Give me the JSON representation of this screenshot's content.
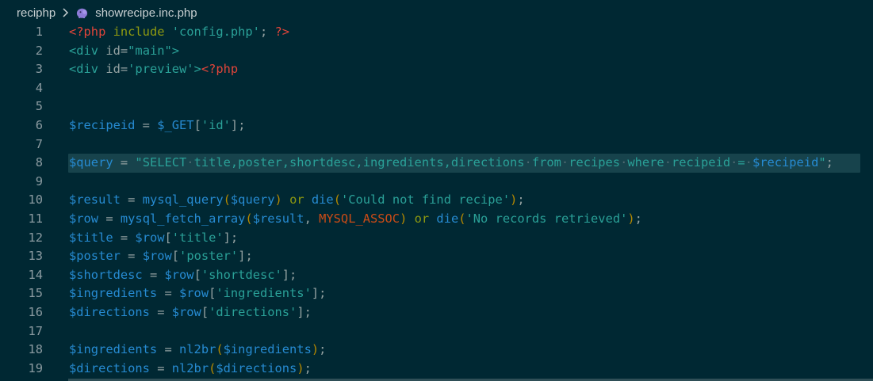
{
  "breadcrumb": {
    "folder": "reciphp",
    "file": "showrecipe.inc.php",
    "file_icon": "php-elephant-icon",
    "separator_icon": "chevron-right-icon"
  },
  "colors": {
    "background": "#002833",
    "line_numbers": "#8a9aa0",
    "highlight": "#17434c",
    "string": "#2aa198",
    "variable": "#268bd2",
    "keyword": "#8f9a10",
    "php_tag": "#e0453a",
    "bracket": "#b58900",
    "constant": "#cb4b16"
  },
  "editor": {
    "highlighted_line": 8,
    "lines": [
      {
        "n": "1",
        "tokens": [
          [
            "tag",
            "<?php"
          ],
          [
            "kw",
            " include "
          ],
          [
            "str",
            "'config.php'"
          ],
          [
            "pun",
            "; "
          ],
          [
            "tag",
            "?>"
          ]
        ]
      },
      {
        "n": "2",
        "tokens": [
          [
            "str",
            "<div "
          ],
          [
            "pun",
            "id="
          ],
          [
            "str",
            "\"main\""
          ],
          [
            "str",
            ">"
          ]
        ]
      },
      {
        "n": "3",
        "tokens": [
          [
            "str",
            "<div "
          ],
          [
            "pun",
            "id="
          ],
          [
            "str",
            "'preview'"
          ],
          [
            "str",
            ">"
          ],
          [
            "tag",
            "<?php"
          ]
        ]
      },
      {
        "n": "4",
        "tokens": []
      },
      {
        "n": "5",
        "tokens": []
      },
      {
        "n": "6",
        "tokens": [
          [
            "var",
            "$recipeid"
          ],
          [
            "pun",
            " = "
          ],
          [
            "var",
            "$_GET"
          ],
          [
            "pun",
            "["
          ],
          [
            "str",
            "'id'"
          ],
          [
            "pun",
            "];"
          ]
        ]
      },
      {
        "n": "7",
        "tokens": []
      },
      {
        "n": "8",
        "tokens": [
          [
            "var",
            "$query"
          ],
          [
            "pun",
            " = "
          ],
          [
            "str",
            "\"SELECT"
          ],
          [
            "dot",
            "·"
          ],
          [
            "str",
            "title,poster,shortdesc,ingredients,directions"
          ],
          [
            "dot",
            "·"
          ],
          [
            "str",
            "from"
          ],
          [
            "dot",
            "·"
          ],
          [
            "str",
            "recipes"
          ],
          [
            "dot",
            "·"
          ],
          [
            "str",
            "where"
          ],
          [
            "dot",
            "·"
          ],
          [
            "str",
            "recipeid"
          ],
          [
            "dot",
            "·"
          ],
          [
            "str",
            "="
          ],
          [
            "dot",
            "·"
          ],
          [
            "var",
            "$recipeid"
          ],
          [
            "str",
            "\""
          ],
          [
            "pun",
            ";"
          ]
        ]
      },
      {
        "n": "9",
        "tokens": []
      },
      {
        "n": "10",
        "tokens": [
          [
            "var",
            "$result"
          ],
          [
            "pun",
            " = "
          ],
          [
            "fn",
            "mysql_query"
          ],
          [
            "br",
            "("
          ],
          [
            "var",
            "$query"
          ],
          [
            "br",
            ")"
          ],
          [
            "kw",
            " or "
          ],
          [
            "fn",
            "die"
          ],
          [
            "br",
            "("
          ],
          [
            "str",
            "'Could not find recipe'"
          ],
          [
            "br",
            ")"
          ],
          [
            "pun",
            ";"
          ]
        ]
      },
      {
        "n": "11",
        "tokens": [
          [
            "var",
            "$row"
          ],
          [
            "pun",
            " = "
          ],
          [
            "fn",
            "mysql_fetch_array"
          ],
          [
            "br",
            "("
          ],
          [
            "var",
            "$result"
          ],
          [
            "pun",
            ", "
          ],
          [
            "const",
            "MYSQL_ASSOC"
          ],
          [
            "br",
            ")"
          ],
          [
            "kw",
            " or "
          ],
          [
            "fn",
            "die"
          ],
          [
            "br",
            "("
          ],
          [
            "str",
            "'No records retrieved'"
          ],
          [
            "br",
            ")"
          ],
          [
            "pun",
            ";"
          ]
        ]
      },
      {
        "n": "12",
        "tokens": [
          [
            "var",
            "$title"
          ],
          [
            "pun",
            " = "
          ],
          [
            "var",
            "$row"
          ],
          [
            "pun",
            "["
          ],
          [
            "str",
            "'title'"
          ],
          [
            "pun",
            "];"
          ]
        ]
      },
      {
        "n": "13",
        "tokens": [
          [
            "var",
            "$poster"
          ],
          [
            "pun",
            " = "
          ],
          [
            "var",
            "$row"
          ],
          [
            "pun",
            "["
          ],
          [
            "str",
            "'poster'"
          ],
          [
            "pun",
            "];"
          ]
        ]
      },
      {
        "n": "14",
        "tokens": [
          [
            "var",
            "$shortdesc"
          ],
          [
            "pun",
            " = "
          ],
          [
            "var",
            "$row"
          ],
          [
            "pun",
            "["
          ],
          [
            "str",
            "'shortdesc'"
          ],
          [
            "pun",
            "];"
          ]
        ]
      },
      {
        "n": "15",
        "tokens": [
          [
            "var",
            "$ingredients"
          ],
          [
            "pun",
            " = "
          ],
          [
            "var",
            "$row"
          ],
          [
            "pun",
            "["
          ],
          [
            "str",
            "'ingredients'"
          ],
          [
            "pun",
            "];"
          ]
        ]
      },
      {
        "n": "16",
        "tokens": [
          [
            "var",
            "$directions"
          ],
          [
            "pun",
            " = "
          ],
          [
            "var",
            "$row"
          ],
          [
            "pun",
            "["
          ],
          [
            "str",
            "'directions'"
          ],
          [
            "pun",
            "];"
          ]
        ]
      },
      {
        "n": "17",
        "tokens": []
      },
      {
        "n": "18",
        "tokens": [
          [
            "var",
            "$ingredients"
          ],
          [
            "pun",
            " = "
          ],
          [
            "fn",
            "nl2br"
          ],
          [
            "br",
            "("
          ],
          [
            "var",
            "$ingredients"
          ],
          [
            "br",
            ")"
          ],
          [
            "pun",
            ";"
          ]
        ]
      },
      {
        "n": "19",
        "tokens": [
          [
            "var",
            "$directions"
          ],
          [
            "pun",
            " = "
          ],
          [
            "fn",
            "nl2br"
          ],
          [
            "br",
            "("
          ],
          [
            "var",
            "$directions"
          ],
          [
            "br",
            ")"
          ],
          [
            "pun",
            ";"
          ]
        ]
      }
    ]
  }
}
